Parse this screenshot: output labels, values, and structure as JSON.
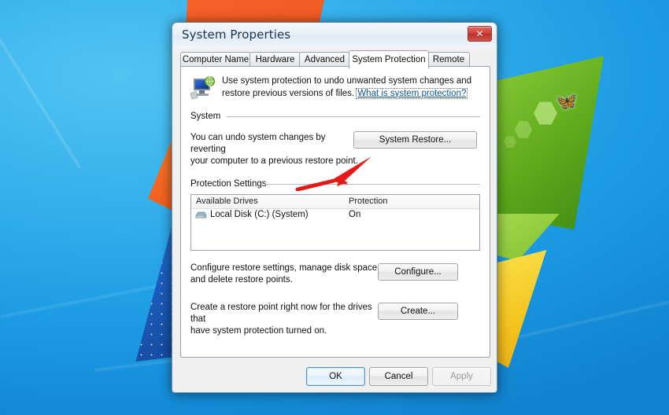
{
  "desktop": {
    "wallpaper_name": "windows-7-default-wallpaper"
  },
  "window": {
    "title": "System Properties",
    "close_label": "✕",
    "close_icon": "close-icon"
  },
  "tabs": [
    {
      "label": "Computer Name",
      "active": false
    },
    {
      "label": "Hardware",
      "active": false
    },
    {
      "label": "Advanced",
      "active": false
    },
    {
      "label": "System Protection",
      "active": true
    },
    {
      "label": "Remote",
      "active": false
    }
  ],
  "header": {
    "icon": "system-protection-computer-icon",
    "text_line1": "Use system protection to undo unwanted system changes and",
    "text_line2": "restore previous versions of files.",
    "link": "What is system protection?"
  },
  "system_group": {
    "label": "System",
    "description_line1": "You can undo system changes by reverting",
    "description_line2": "your computer to a previous restore point.",
    "button": "System Restore..."
  },
  "protection_group": {
    "label": "Protection Settings",
    "columns": [
      "Available Drives",
      "Protection"
    ],
    "rows": [
      {
        "icon": "hard-drive-icon",
        "drive": "Local Disk (C:) (System)",
        "protection": "On"
      }
    ]
  },
  "configure_section": {
    "description_line1": "Configure restore settings, manage disk space,",
    "description_line2": "and delete restore points.",
    "button": "Configure..."
  },
  "create_section": {
    "description_line1": "Create a restore point right now for the drives that",
    "description_line2": "have system protection turned on.",
    "button": "Create..."
  },
  "footer": {
    "ok": "OK",
    "cancel": "Cancel",
    "apply": "Apply"
  },
  "annotation": {
    "name": "red-arrow-pointing-to-system-restore",
    "color": "#e21b19"
  },
  "colors": {
    "accent": "#14548c",
    "close_red": "#d0423a",
    "desktop_blue": "#32aeeb",
    "arrow_red": "#e21b19"
  }
}
